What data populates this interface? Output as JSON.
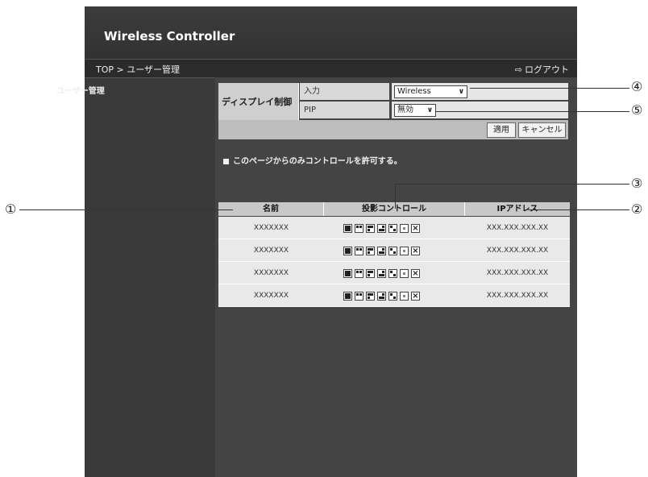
{
  "header": {
    "title": "Wireless Controller"
  },
  "nav": {
    "breadcrumb": "TOP > ユーザー管理",
    "logout_icon": "logout-icon",
    "logout_label": "ログアウト"
  },
  "sidebar": {
    "label": "ユーザー管理"
  },
  "display_control": {
    "title": "ディスプレイ制御",
    "input_label": "入力",
    "input_value": "Wireless",
    "pip_label": "PIP",
    "pip_value": "無効",
    "apply_label": "適用",
    "cancel_label": "キャンセル"
  },
  "page_control": {
    "label": "このページからのみコントロールを許可する。"
  },
  "table": {
    "headers": [
      "名前",
      "投影コントロール",
      "IPアドレス"
    ],
    "rows": [
      {
        "name": "XXXXXXX",
        "ip": "XXX.XXX.XXX.XX"
      },
      {
        "name": "XXXXXXX",
        "ip": "XXX.XXX.XXX.XX"
      },
      {
        "name": "XXXXXXX",
        "ip": "XXX.XXX.XXX.XX"
      },
      {
        "name": "XXXXXXX",
        "ip": "XXX.XXX.XXX.XX"
      }
    ]
  },
  "callouts": {
    "c1": "①",
    "c2": "②",
    "c3": "③",
    "c4": "④",
    "c5": "⑤"
  }
}
